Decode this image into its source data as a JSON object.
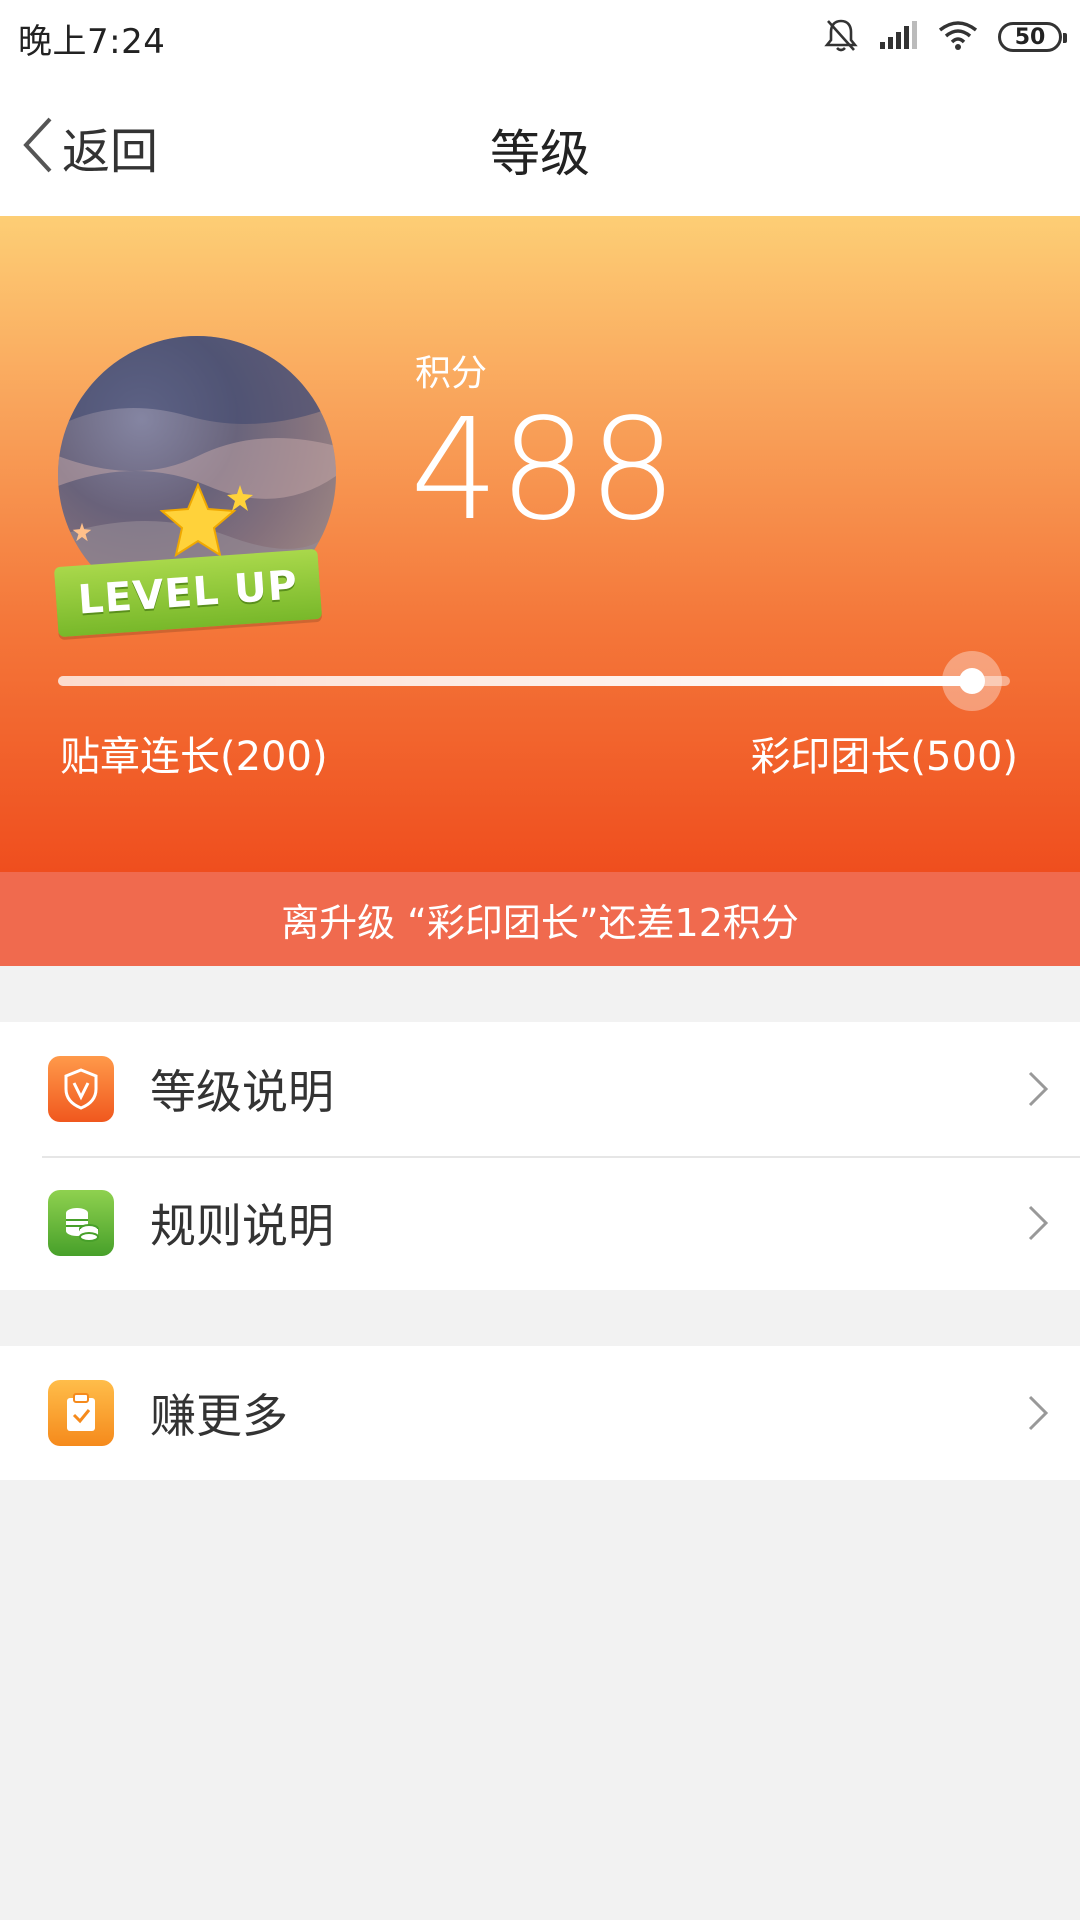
{
  "status_bar": {
    "time": "晚上7:24",
    "battery": "50",
    "icons": [
      "mute-bell-icon",
      "signal-icon",
      "wifi-icon",
      "battery-icon"
    ]
  },
  "nav": {
    "back_label": "返回",
    "title": "等级"
  },
  "hero": {
    "badge_text": "LEVEL UP",
    "points_label": "积分",
    "points_value": "488",
    "level_left": "贴章连长(200)",
    "level_right": "彩印团长(500)",
    "progress_fraction": 0.96,
    "gradient_top": "#fdce75",
    "gradient_bottom": "#ef4e1e"
  },
  "hint": {
    "text": "离升级 “彩印团长”还差12积分",
    "background": "#f06a4e"
  },
  "menu": {
    "group1": [
      {
        "label": "等级说明",
        "icon": "shield-v-icon",
        "color": "#f0581e"
      },
      {
        "label": "规则说明",
        "icon": "coins-stack-icon",
        "color": "#47a02a"
      }
    ],
    "group2": [
      {
        "label": "赚更多",
        "icon": "clipboard-check-icon",
        "color": "#f58a1c"
      }
    ]
  }
}
